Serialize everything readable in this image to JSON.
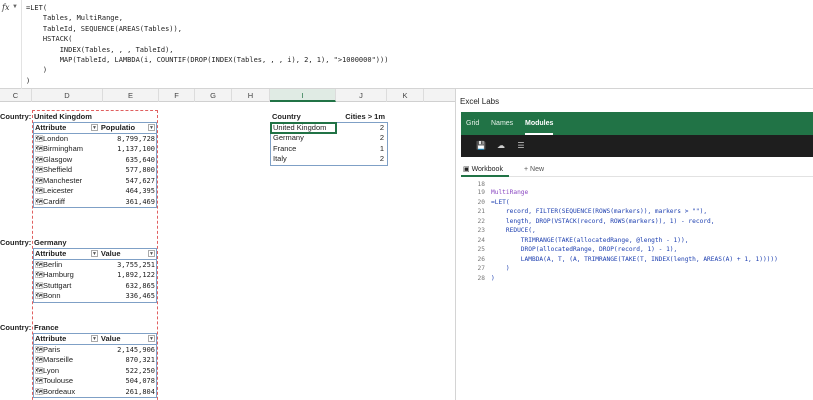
{
  "formula_bar": {
    "fx_label": "fx",
    "code": "=LET(\n    Tables, MultiRange,\n    TableId, SEQUENCE(AREAS(Tables)),\n    HSTACK(\n        INDEX(Tables, , , TableId),\n        MAP(TableId, LAMBDA(i, COUNTIF(DROP(INDEX(Tables, , , i), 2, 1), \">1000000\")))\n    )\n)"
  },
  "columns": [
    "C",
    "D",
    "E",
    "F",
    "G",
    "H",
    "I",
    "J",
    "K"
  ],
  "active_column": "I",
  "country_label": "Country:",
  "blocks": [
    {
      "name": "United Kingdom",
      "headers": [
        "Attribute",
        "Populatio"
      ],
      "rows": [
        {
          "city": "London",
          "value": "8,799,728"
        },
        {
          "city": "Birmingham",
          "value": "1,137,100"
        },
        {
          "city": "Glasgow",
          "value": "635,640"
        },
        {
          "city": "Sheffield",
          "value": "577,800"
        },
        {
          "city": "Manchester",
          "value": "547,627"
        },
        {
          "city": "Leicester",
          "value": "464,395"
        },
        {
          "city": "Cardiff",
          "value": "361,469"
        }
      ]
    },
    {
      "name": "Germany",
      "headers": [
        "Attribute",
        "Value"
      ],
      "rows": [
        {
          "city": "Berlin",
          "value": "3,755,251"
        },
        {
          "city": "Hamburg",
          "value": "1,892,122"
        },
        {
          "city": "Stuttgart",
          "value": "632,865"
        },
        {
          "city": "Bonn",
          "value": "336,465"
        }
      ]
    },
    {
      "name": "France",
      "headers": [
        "Attribute",
        "Value"
      ],
      "rows": [
        {
          "city": "Paris",
          "value": "2,145,906"
        },
        {
          "city": "Marseille",
          "value": "870,321"
        },
        {
          "city": "Lyon",
          "value": "522,250"
        },
        {
          "city": "Toulouse",
          "value": "504,078"
        },
        {
          "city": "Bordeaux",
          "value": "261,804"
        }
      ]
    }
  ],
  "summary": {
    "headers": [
      "Country",
      "Cities > 1m"
    ],
    "rows": [
      {
        "country": "United Kingdom",
        "count": "2"
      },
      {
        "country": "Germany",
        "count": "2"
      },
      {
        "country": "France",
        "count": "1"
      },
      {
        "country": "Italy",
        "count": "2"
      }
    ]
  },
  "pane": {
    "title": "Excel Labs",
    "tabs": [
      "Grid",
      "Names",
      "Modules"
    ],
    "active_tab": "Modules",
    "workbook_tab": "Workbook",
    "new_tab": "+ New",
    "accent": "#217346",
    "code_lines": [
      {
        "n": "18",
        "t": ""
      },
      {
        "n": "19",
        "t": "MultiRange"
      },
      {
        "n": "20",
        "t": "=LET("
      },
      {
        "n": "21",
        "t": "    record, FILTER(SEQUENCE(ROWS(markers)), markers > \"\"),"
      },
      {
        "n": "22",
        "t": "    length, DROP(VSTACK(record, ROWS(markers)), 1) - record,"
      },
      {
        "n": "23",
        "t": "    REDUCE(,"
      },
      {
        "n": "24",
        "t": "        TRIMRANGE(TAKE(allocatedRange, @length - 1)),"
      },
      {
        "n": "25",
        "t": "        DROP(allocatedRange, DROP(record, 1) - 1),"
      },
      {
        "n": "26",
        "t": "        LAMBDA(A, T, (A, TRIMRANGE(TAKE(T, INDEX(length, AREAS(A) + 1, 1)))))"
      },
      {
        "n": "27",
        "t": "    )"
      },
      {
        "n": "28",
        "t": ")"
      }
    ]
  }
}
